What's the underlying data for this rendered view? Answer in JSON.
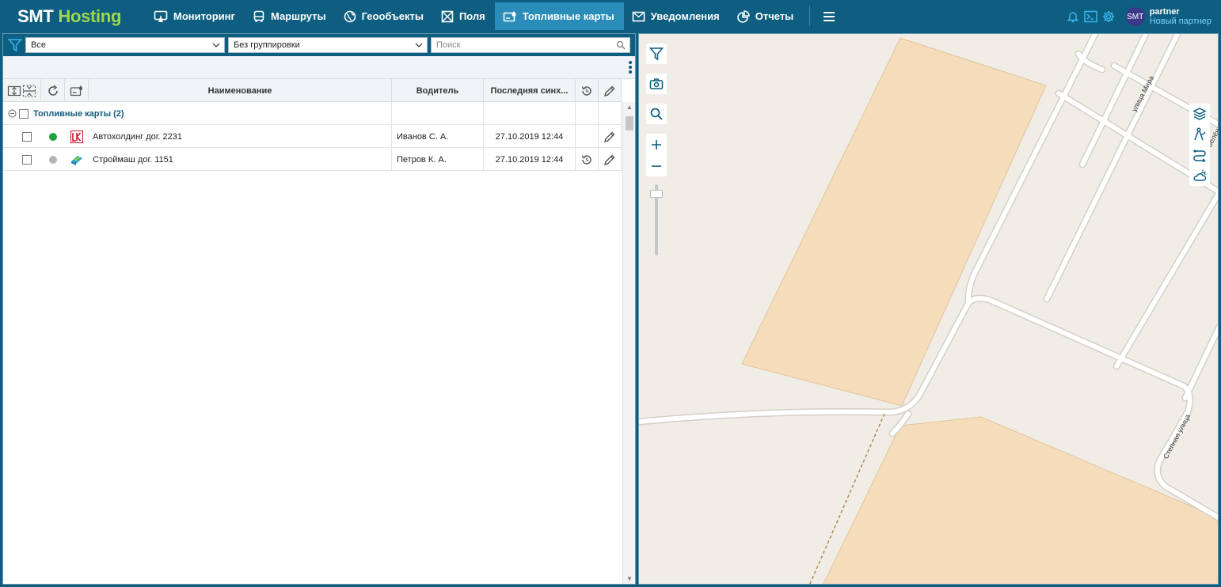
{
  "app": {
    "logo_part1": "SMT",
    "logo_part2": "Hosting"
  },
  "nav": {
    "items": [
      {
        "label": "Мониторинг",
        "icon": "monitor-icon"
      },
      {
        "label": "Маршруты",
        "icon": "bus-icon"
      },
      {
        "label": "Геообъекты",
        "icon": "globe-icon"
      },
      {
        "label": "Поля",
        "icon": "field-icon"
      },
      {
        "label": "Топливные карты",
        "icon": "fuel-card-icon",
        "active": true
      },
      {
        "label": "Уведомления",
        "icon": "envelope-icon"
      },
      {
        "label": "Отчеты",
        "icon": "pie-chart-icon"
      }
    ]
  },
  "user": {
    "avatar": "SMT",
    "name": "partner",
    "partner_link": "Новый партнер"
  },
  "filters": {
    "status_value": "Все",
    "grouping_value": "Без группировки",
    "search_placeholder": "Поиск"
  },
  "table": {
    "columns": {
      "name": "Наименование",
      "driver": "Водитель",
      "last_sync": "Последняя синх..."
    },
    "group": {
      "title": "Топливные карты (2)"
    },
    "rows": [
      {
        "name": "Автохолдинг дог. 2231",
        "driver": "Иванов С. А.",
        "last_sync": "27.10.2019 12:44",
        "status_color": "#1aa33a",
        "provider_logo": "lukoil-logo"
      },
      {
        "name": "Строймаш дог. 1151",
        "driver": "Петров К. А.",
        "last_sync": "27.10.2019 12:44",
        "status_color": "#b5b5b5",
        "provider_logo": "fuel-card-logo"
      }
    ]
  },
  "map": {
    "street_1": "улица Мира",
    "street_2": "Степная улица",
    "street_3": "Зелёная"
  },
  "colors": {
    "header_bg": "#0d5e80",
    "active_tab": "#2a8cb8",
    "logo_accent": "#9ed94a",
    "map_bg": "#f0ede7",
    "map_area": "#f5dcbb"
  }
}
